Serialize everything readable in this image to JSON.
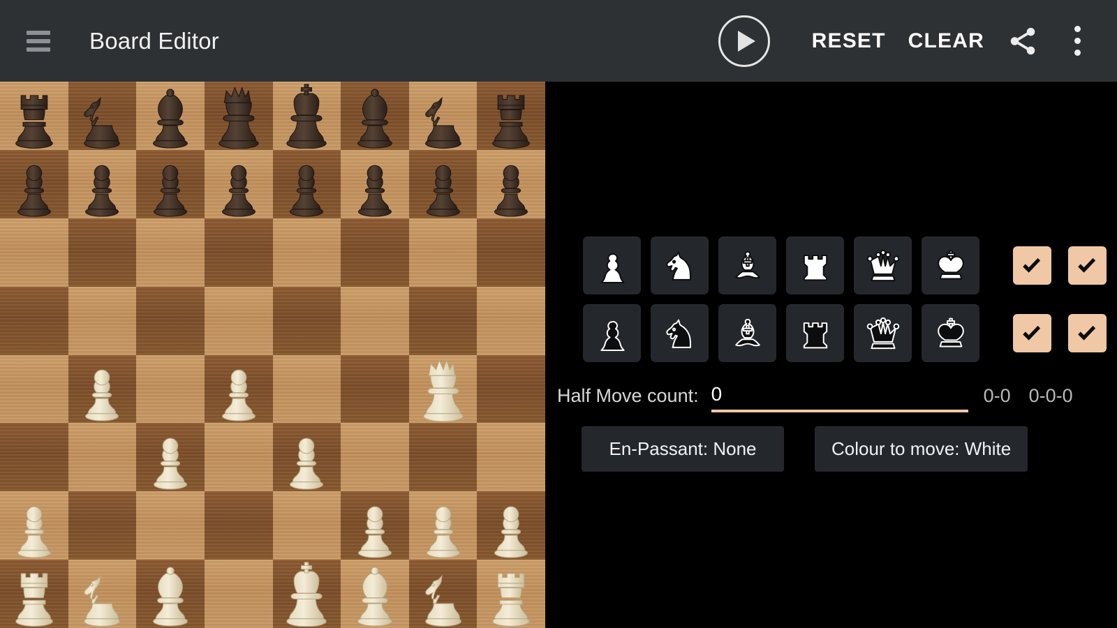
{
  "toolbar": {
    "menu_icon": "hamburger-menu-icon",
    "title": "Board Editor",
    "play_icon": "play-circle-icon",
    "reset_label": "RESET",
    "clear_label": "CLEAR",
    "share_icon": "share-icon",
    "overflow_icon": "more-vertical-icon"
  },
  "board": {
    "light_square_color": "#c99a66",
    "dark_square_color": "#88592f",
    "orientation": "white-bottom",
    "ranks": [
      [
        "br",
        "bn",
        "bb",
        "bq",
        "bk",
        "bb",
        "bn",
        "br"
      ],
      [
        "bp",
        "bp",
        "bp",
        "bp",
        "bp",
        "bp",
        "bp",
        "bp"
      ],
      [
        "",
        "",
        "",
        "",
        "",
        "",
        "",
        ""
      ],
      [
        "",
        "",
        "",
        "",
        "",
        "",
        "",
        ""
      ],
      [
        "",
        "wp",
        "",
        "wp",
        "",
        "",
        "wq",
        ""
      ],
      [
        "",
        "",
        "wp",
        "",
        "wp",
        "",
        "",
        ""
      ],
      [
        "wp",
        "",
        "",
        "",
        "",
        "wp",
        "wp",
        "wp"
      ],
      [
        "wr",
        "wn",
        "wb",
        "",
        "wk",
        "wb",
        "wn",
        "wr"
      ]
    ]
  },
  "palette": {
    "white_row": [
      {
        "name": "white-pawn",
        "piece": "wp"
      },
      {
        "name": "white-knight",
        "piece": "wn"
      },
      {
        "name": "white-bishop",
        "piece": "wb"
      },
      {
        "name": "white-rook",
        "piece": "wr"
      },
      {
        "name": "white-queen",
        "piece": "wq"
      },
      {
        "name": "white-king",
        "piece": "wk"
      }
    ],
    "black_row": [
      {
        "name": "black-pawn",
        "piece": "bp"
      },
      {
        "name": "black-knight",
        "piece": "bn"
      },
      {
        "name": "black-bishop",
        "piece": "bb"
      },
      {
        "name": "black-rook",
        "piece": "br"
      },
      {
        "name": "black-queen",
        "piece": "bq"
      },
      {
        "name": "black-king",
        "piece": "bk"
      }
    ],
    "checkboxes": {
      "white_kingside": true,
      "white_queenside": true,
      "black_kingside": true,
      "black_queenside": true,
      "checked_color": "#f0c8a6",
      "check_icon": "checkmark-icon"
    },
    "tile_color": "#24282c"
  },
  "controls": {
    "half_move_label": "Half Move count:",
    "half_move_value": "0",
    "half_move_placeholder": "0",
    "castle_kingside_label": "0-0",
    "castle_queenside_label": "0-0-0",
    "en_passant_label": "En-Passant: None",
    "colour_to_move_label": "Colour to move: White",
    "accent_color": "#f0c8a6"
  }
}
